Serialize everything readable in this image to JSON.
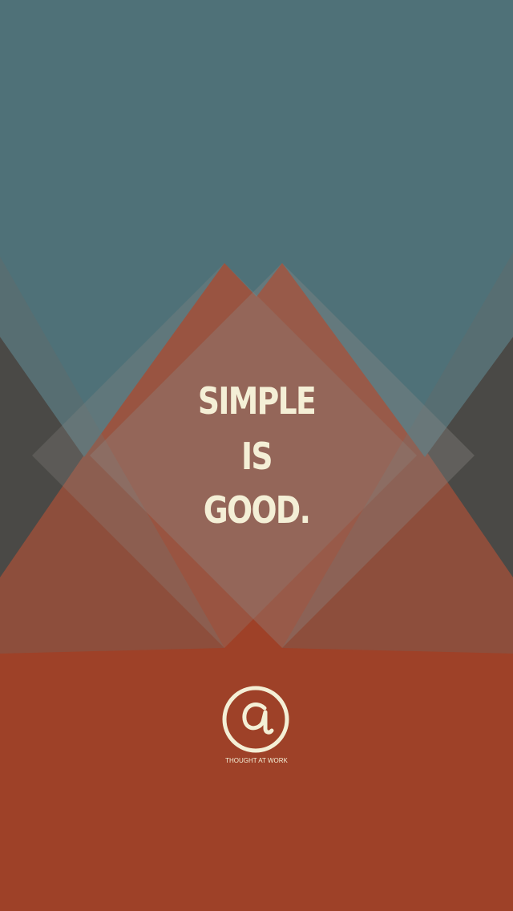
{
  "quote": {
    "line1": "SIMPLE",
    "line2": "IS",
    "line3": "GOOD."
  },
  "brand": {
    "name": "THOUGHT AT WORK",
    "logo_icon": "at-sign-icon"
  },
  "colors": {
    "sky": "#4f7178",
    "rust": "#9e4128",
    "charcoal": "#3c3a37",
    "cream": "#f4efd6"
  }
}
